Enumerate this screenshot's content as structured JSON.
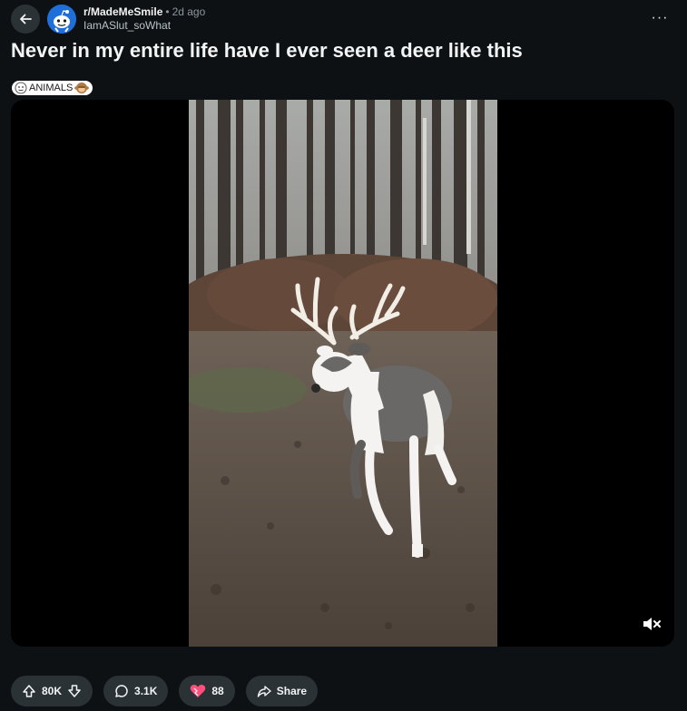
{
  "header": {
    "subreddit": "r/MadeMeSmile",
    "separator": "•",
    "time": "2d ago",
    "author": "IamASlut_soWhat",
    "more_label": "···"
  },
  "post": {
    "title": "Never in my entire life have I ever seen a deer like this",
    "flair": "ANIMALS"
  },
  "actions": {
    "votes": "80K",
    "comments": "3.1K",
    "awards": "88",
    "share": "Share"
  },
  "colors": {
    "background": "#0e1113",
    "pill": "#2a3236",
    "avatar": "#1e6fd9",
    "award_heart": "#ff4f7a"
  },
  "icons": [
    "back-arrow-icon",
    "snoo-avatar-icon",
    "more-icon",
    "flair-emoji-icon",
    "mute-icon",
    "upvote-icon",
    "downvote-icon",
    "comment-icon",
    "award-heart-icon",
    "share-icon"
  ]
}
